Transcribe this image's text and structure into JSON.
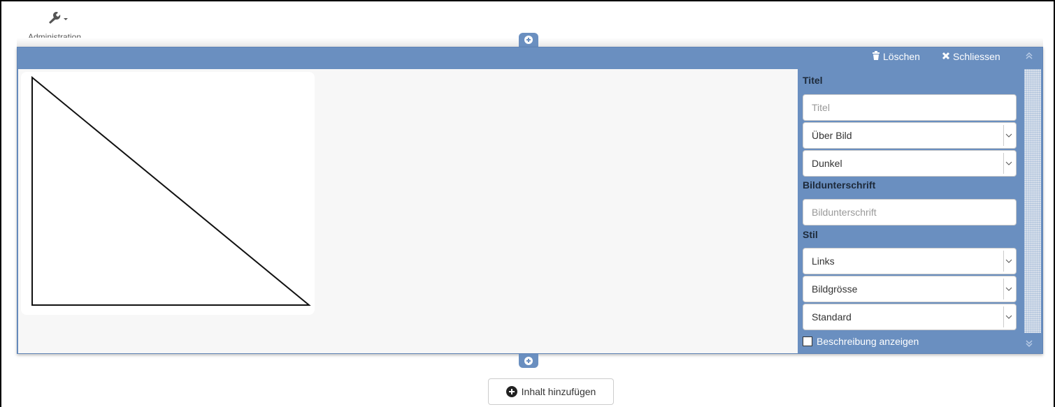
{
  "toolbar": {
    "admin_label": "Administration",
    "admin_icon": "wrench-icon"
  },
  "panel": {
    "delete_label": "Löschen",
    "close_label": "Schliessen",
    "accent_color": "#6a8fc0"
  },
  "sidebar": {
    "title_section": "Titel",
    "title_placeholder": "Titel",
    "title_position": "Über Bild",
    "title_theme": "Dunkel",
    "caption_section": "Bildunterschrift",
    "caption_placeholder": "Bildunterschrift",
    "style_section": "Stil",
    "align": "Links",
    "image_size": "Bildgrösse",
    "variant": "Standard",
    "show_description_label": "Beschreibung anzeigen",
    "show_description_checked": false
  },
  "footer": {
    "add_content_label": "Inhalt hinzufügen"
  }
}
